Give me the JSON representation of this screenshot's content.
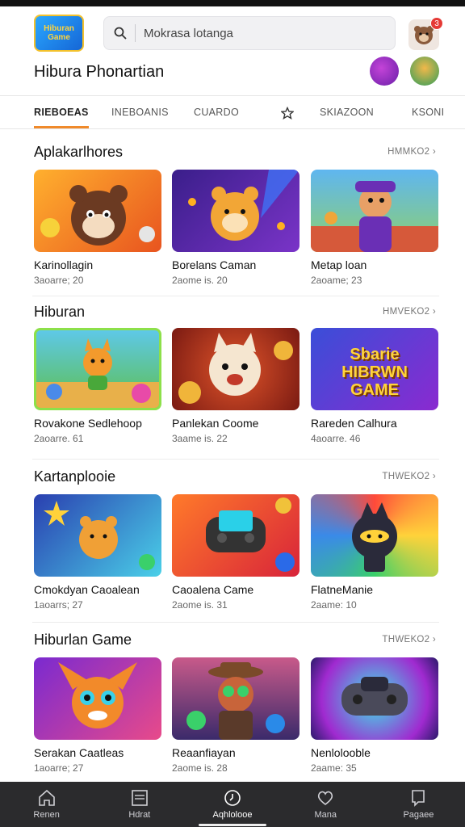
{
  "header": {
    "logo_text": "Hiburan Game",
    "search_placeholder": "Mokrasa lotanga",
    "notification_count": "3"
  },
  "brand": {
    "title": "Hibura Phonartian"
  },
  "tabs": [
    {
      "label": "RIEBOEAS",
      "active": true
    },
    {
      "label": "INEBOANIS",
      "active": false
    },
    {
      "label": "CUARDO",
      "active": false
    },
    {
      "label": "",
      "icon": "star-icon",
      "active": false
    },
    {
      "label": "SKIAZOON",
      "active": false
    },
    {
      "label": "KSONI",
      "active": false
    }
  ],
  "sections": [
    {
      "title": "Aplakarlhores",
      "more": "HMMKO2 ›",
      "cards": [
        {
          "name": "Karinollagin",
          "meta": "3aoarre; 20"
        },
        {
          "name": "Borelans Caman",
          "meta": "2aome is. 20"
        },
        {
          "name": "Metap loan",
          "meta": "2aoame; 23"
        }
      ]
    },
    {
      "title": "Hiburan",
      "more": "HMVEKO2 ›",
      "cards": [
        {
          "name": "Rovakone Sedlehoop",
          "meta": "2aoarre. 61"
        },
        {
          "name": "Panlekan Coome",
          "meta": "3aame is. 22"
        },
        {
          "name": "Rareden Calhura",
          "meta": "4aoarre. 46"
        }
      ]
    },
    {
      "title": "Kartanplooie",
      "more": "THWEKO2 ›",
      "cards": [
        {
          "name": "Cmokdyan Caoalean",
          "meta": "1aoarrs; 27"
        },
        {
          "name": "Caoalena Came",
          "meta": "2aome is. 31"
        },
        {
          "name": "FlatneManie",
          "meta": "2aame: 10"
        }
      ]
    },
    {
      "title": "Hiburlan Game",
      "more": "THWEKO2 ›",
      "cards": [
        {
          "name": "Serakan Caatleas",
          "meta": "1aoarre; 27"
        },
        {
          "name": "Reaanfiayan",
          "meta": "2aome is. 28"
        },
        {
          "name": "Nenlolooble",
          "meta": "2aame: 35"
        }
      ]
    }
  ],
  "thumb_art": {
    "s3c1": "Sbarie HIBRWN GAME"
  },
  "bottom_nav": [
    {
      "label": "Renen",
      "icon": "home-icon"
    },
    {
      "label": "Hdrat",
      "icon": "list-icon"
    },
    {
      "label": "Aqhlolooe",
      "icon": "clock-icon",
      "active": true
    },
    {
      "label": "Mana",
      "icon": "heart-icon"
    },
    {
      "label": "Pagaee",
      "icon": "page-icon"
    }
  ],
  "colors": {
    "accent": "#f08a2a",
    "nav_bg": "#2b2b2d",
    "badge": "#e53935"
  }
}
